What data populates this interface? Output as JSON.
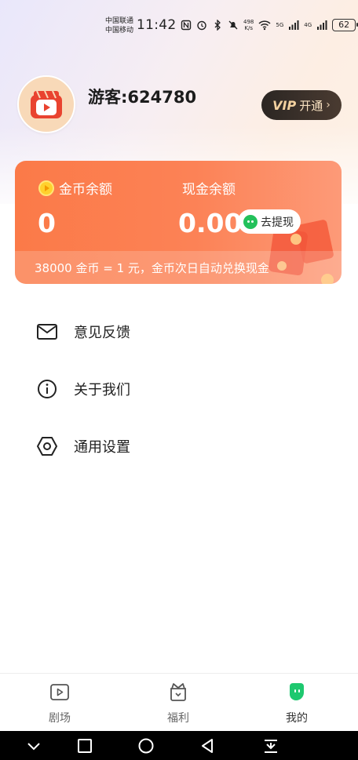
{
  "status_bar": {
    "carrier_1": "中国联通",
    "carrier_2": "中国移动",
    "time": "11:42",
    "net_speed_value": "498",
    "net_speed_unit": "K/s",
    "signal_1_label": "5G",
    "signal_2_label": "4G",
    "battery": "62"
  },
  "profile": {
    "username": "游客:624780",
    "vip_badge": "VIP",
    "vip_label": "开通",
    "vip_chevron": "›"
  },
  "wallet": {
    "coin_label": "金币余额",
    "coin_value": "0",
    "cash_label": "现金余额",
    "cash_value": "0.00",
    "withdraw_label": "去提现",
    "exchange_note": "38000 金币 = 1 元，金币次日自动兑换现金"
  },
  "menu": [
    {
      "label": "意见反馈",
      "icon": "mail-icon"
    },
    {
      "label": "关于我们",
      "icon": "info-icon"
    },
    {
      "label": "通用设置",
      "icon": "settings-icon"
    }
  ],
  "tabs": [
    {
      "label": "剧场",
      "icon": "theater-icon"
    },
    {
      "label": "福利",
      "icon": "gift-icon"
    },
    {
      "label": "我的",
      "icon": "profile-icon",
      "active": true
    }
  ],
  "colors": {
    "wallet_orange": "#fb7a48",
    "active_tab_green": "#1ec86f",
    "vip_dark": "#2b2623"
  }
}
